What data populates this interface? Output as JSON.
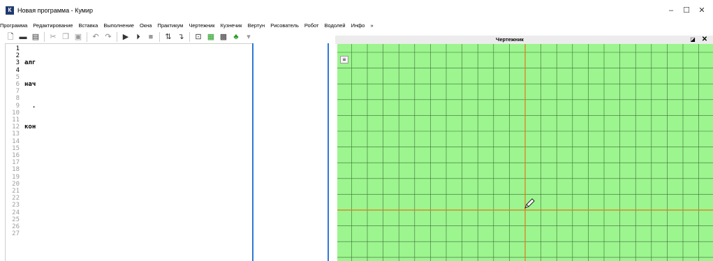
{
  "window": {
    "title": "Новая программа - Кумир",
    "app_icon": "К",
    "minimize": "–",
    "maximize": "☐",
    "close": "✕"
  },
  "menu": [
    "Программа",
    "Редактирование",
    "Вставка",
    "Выполнение",
    "Окна",
    "Практикум",
    "Чертежник",
    "Кузнечик",
    "Вертун",
    "Рисователь",
    "Робот",
    "Водолей",
    "Инфо",
    "»"
  ],
  "toolbar": {
    "icons": [
      "new-file-icon",
      "open-folder-icon",
      "save-icon",
      "cut-icon",
      "copy-icon",
      "paste-icon",
      "undo-icon",
      "redo-icon",
      "run-icon",
      "step-run-icon",
      "stop-icon",
      "step-over-icon",
      "step-into-icon",
      "info-icon",
      "robot-icon",
      "drawer-grid-icon",
      "grasshopper-icon",
      "more-icon"
    ]
  },
  "editor": {
    "line_numbers": [
      "1",
      "2",
      "3",
      "4",
      "5",
      "6",
      "7",
      "8",
      "9",
      "10",
      "11",
      "12",
      "13",
      "14",
      "15",
      "16",
      "17",
      "18",
      "19",
      "20",
      "21",
      "22",
      "23",
      "24",
      "25",
      "26",
      "27"
    ],
    "code_lines": [
      "алг",
      "нач",
      "  .",
      "кон"
    ]
  },
  "drawer": {
    "title": "Чертежник",
    "restore_glyph": "◪",
    "close_glyph": "✕",
    "menu_glyph": "≡"
  },
  "colors": {
    "canvas_bg": "#9cf58e",
    "grid_line": "#3e6b39",
    "axis_line": "#e0791a",
    "editor_border": "#2b79d6"
  }
}
